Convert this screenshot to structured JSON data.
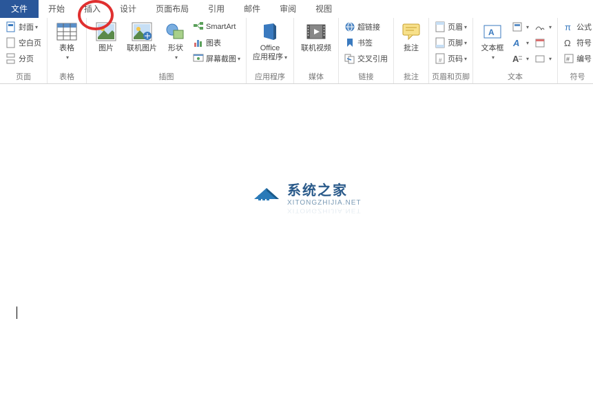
{
  "tabs": {
    "file": "文件",
    "home": "开始",
    "insert": "插入",
    "design": "设计",
    "layout": "页面布局",
    "references": "引用",
    "mail": "邮件",
    "review": "审阅",
    "view": "视图"
  },
  "groups": {
    "pages": {
      "label": "页面",
      "cover": "封面",
      "blank": "空白页",
      "break": "分页"
    },
    "tables": {
      "label": "表格",
      "table": "表格"
    },
    "illustrations": {
      "label": "插图",
      "picture": "图片",
      "online_picture": "联机图片",
      "shapes": "形状",
      "smartart": "SmartArt",
      "chart": "图表",
      "screenshot": "屏幕截图"
    },
    "apps": {
      "label": "应用程序",
      "office_apps": "Office\n应用程序"
    },
    "media": {
      "label": "媒体",
      "online_video": "联机视频"
    },
    "links": {
      "label": "链接",
      "hyperlink": "超链接",
      "bookmark": "书签",
      "crossref": "交叉引用"
    },
    "comments": {
      "label": "批注",
      "comment": "批注"
    },
    "header_footer": {
      "label": "页眉和页脚",
      "header": "页眉",
      "footer": "页脚",
      "page_number": "页码"
    },
    "text": {
      "label": "文本",
      "textbox": "文本框"
    },
    "symbols": {
      "label": "符号",
      "equation": "公式",
      "symbol": "符号",
      "numbering": "编号"
    }
  },
  "watermark": {
    "title": "系统之家",
    "subtitle": "XITONGZHIJIA.NET"
  },
  "highlight": "insert"
}
